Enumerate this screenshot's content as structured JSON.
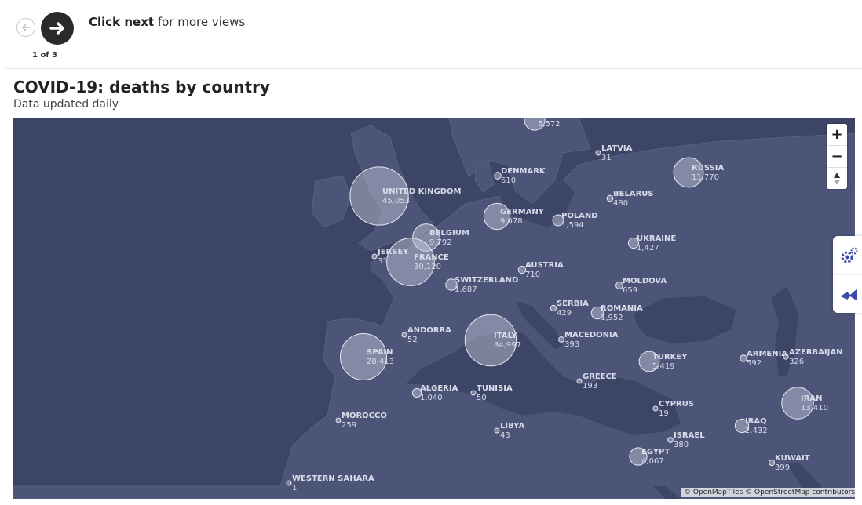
{
  "navigation": {
    "counter": "1 of 3",
    "hint_bold": "Click next",
    "hint_rest": " for more views"
  },
  "header": {
    "title": "COVID-19: deaths by country",
    "subtitle": "Data updated daily"
  },
  "map": {
    "attribution": "© OpenMapTiles © OpenStreetMap contributors",
    "colors": {
      "ocean": "#3c4565",
      "land": "#4c5578",
      "bubble_fill": "#c7cbdc",
      "label": "#d8dcea"
    },
    "countries": [
      {
        "name": "",
        "value": "5,572",
        "deaths": 5572
      },
      {
        "name": "LATVIA",
        "value": "31",
        "deaths": 31
      },
      {
        "name": "DENMARK",
        "value": "610",
        "deaths": 610
      },
      {
        "name": "RUSSIA",
        "value": "11,770",
        "deaths": 11770
      },
      {
        "name": "BELARUS",
        "value": "480",
        "deaths": 480
      },
      {
        "name": "UNITED KINGDOM",
        "value": "45,053",
        "deaths": 45053
      },
      {
        "name": "GERMANY",
        "value": "9,078",
        "deaths": 9078
      },
      {
        "name": "POLAND",
        "value": "1,594",
        "deaths": 1594
      },
      {
        "name": "BELGIUM",
        "value": "9,792",
        "deaths": 9792
      },
      {
        "name": "UKRAINE",
        "value": "1,427",
        "deaths": 1427
      },
      {
        "name": "JERSEY",
        "value": "31",
        "deaths": 31
      },
      {
        "name": "FRANCE",
        "value": "30,120",
        "deaths": 30120
      },
      {
        "name": "AUSTRIA",
        "value": "710",
        "deaths": 710
      },
      {
        "name": "SWITZERLAND",
        "value": "1,687",
        "deaths": 1687
      },
      {
        "name": "MOLDOVA",
        "value": "659",
        "deaths": 659
      },
      {
        "name": "SERBIA",
        "value": "429",
        "deaths": 429
      },
      {
        "name": "ROMANIA",
        "value": "1,952",
        "deaths": 1952
      },
      {
        "name": "ANDORRA",
        "value": "52",
        "deaths": 52
      },
      {
        "name": "ITALY",
        "value": "34,997",
        "deaths": 34997
      },
      {
        "name": "MACEDONIA",
        "value": "393",
        "deaths": 393
      },
      {
        "name": "SPAIN",
        "value": "28,413",
        "deaths": 28413
      },
      {
        "name": "ARMENIA",
        "value": "592",
        "deaths": 592
      },
      {
        "name": "AZERBAIJAN",
        "value": "326",
        "deaths": 326
      },
      {
        "name": "TURKEY",
        "value": "5,419",
        "deaths": 5419
      },
      {
        "name": "GREECE",
        "value": "193",
        "deaths": 193
      },
      {
        "name": "ALGERIA",
        "value": "1,040",
        "deaths": 1040
      },
      {
        "name": "TUNISIA",
        "value": "50",
        "deaths": 50
      },
      {
        "name": "IRAN",
        "value": "13,410",
        "deaths": 13410
      },
      {
        "name": "CYPRUS",
        "value": "19",
        "deaths": 19
      },
      {
        "name": "IRAQ",
        "value": "2,432",
        "deaths": 2432
      },
      {
        "name": "MOROCCO",
        "value": "259",
        "deaths": 259
      },
      {
        "name": "LIBYA",
        "value": "43",
        "deaths": 43
      },
      {
        "name": "ISRAEL",
        "value": "380",
        "deaths": 380
      },
      {
        "name": "EGYPT",
        "value": "4,067",
        "deaths": 4067
      },
      {
        "name": "KUWAIT",
        "value": "399",
        "deaths": 399
      },
      {
        "name": "WESTERN SAHARA",
        "value": "1",
        "deaths": 1
      }
    ]
  },
  "icons": {
    "prev": "arrow-left-icon",
    "next": "arrow-right-icon",
    "zoom_in": "plus-icon",
    "zoom_out": "minus-icon",
    "reset": "compass-icon",
    "settings": "gears-icon",
    "share": "share-icon"
  }
}
